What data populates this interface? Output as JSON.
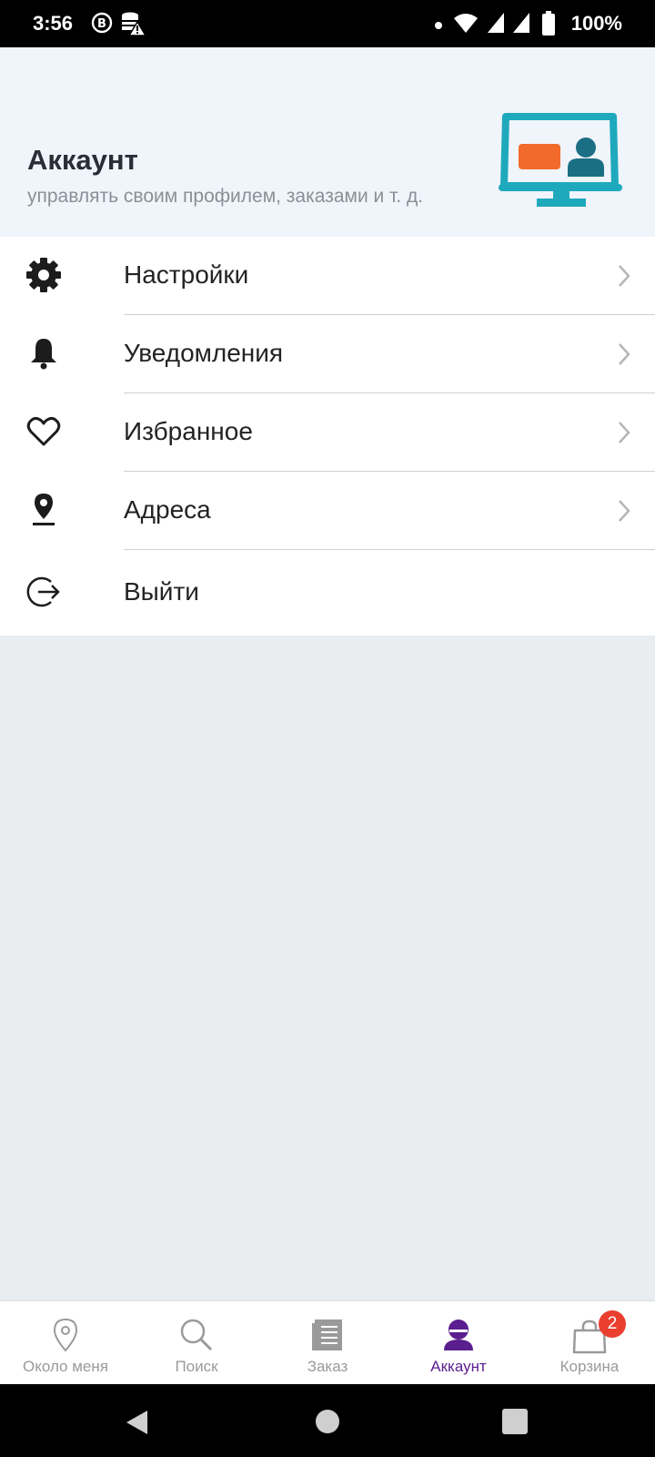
{
  "status_bar": {
    "time": "3:56",
    "battery": "100%",
    "icons": [
      "b-circle-icon",
      "database-warning-icon",
      "dot-icon",
      "wifi-icon",
      "signal-icon",
      "signal-icon",
      "battery-icon"
    ]
  },
  "header": {
    "title": "Аккаунт",
    "subtitle": "управлять своим профилем, заказами и т. д.",
    "illustration_icon": "monitor-profile-icon"
  },
  "menu": {
    "items": [
      {
        "label": "Настройки",
        "icon": "gear-icon",
        "has_chevron": true
      },
      {
        "label": "Уведомления",
        "icon": "bell-icon",
        "has_chevron": true
      },
      {
        "label": "Избранное",
        "icon": "heart-icon",
        "has_chevron": true
      },
      {
        "label": "Адреса",
        "icon": "location-pin-icon",
        "has_chevron": true
      },
      {
        "label": "Выйти",
        "icon": "logout-icon",
        "has_chevron": false
      }
    ]
  },
  "bottom_nav": {
    "items": [
      {
        "label": "Около меня",
        "icon": "location-pin-icon",
        "active": false
      },
      {
        "label": "Поиск",
        "icon": "search-icon",
        "active": false
      },
      {
        "label": "Заказ",
        "icon": "order-list-icon",
        "active": false
      },
      {
        "label": "Аккаунт",
        "icon": "user-icon",
        "active": true
      },
      {
        "label": "Корзина",
        "icon": "shopping-bag-icon",
        "active": false,
        "badge": "2"
      }
    ]
  },
  "colors": {
    "accent": "#5a1e8f",
    "header_bg": "#f0f4fb",
    "page_bg": "#e9edf0",
    "badge": "#ea3e2f",
    "monitor": "#1fa9bd",
    "card_orange": "#f26b2c",
    "person_teal": "#1b6f84"
  }
}
